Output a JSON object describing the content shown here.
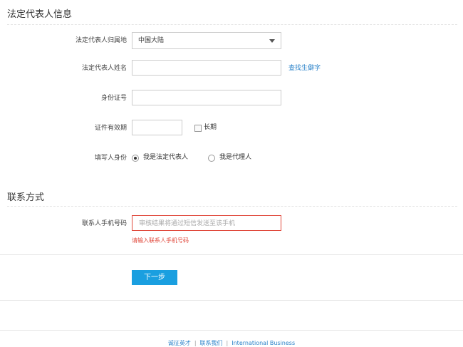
{
  "legal_section": {
    "title": "法定代表人信息",
    "region_label": "法定代表人归属地",
    "region_value": "中国大陆",
    "name_label": "法定代表人姓名",
    "name_value": "",
    "find_char_link": "查找生僻字",
    "id_label": "身份证号",
    "id_value": "",
    "validity_label": "证件有效期",
    "validity_value": "",
    "longterm_label": "长期",
    "filler_label": "填写人身份",
    "filler_option_self": "我是法定代表人",
    "filler_option_agent": "我是代理人",
    "filler_selected": "我是法定代表人"
  },
  "contact_section": {
    "title": "联系方式",
    "phone_label": "联系人手机号码",
    "phone_placeholder": "审核结果将通过短信发送至该手机",
    "phone_error": "请输入联系人手机号码"
  },
  "actions": {
    "next_label": "下一步"
  },
  "footer": {
    "links": [
      "诚征英才",
      "联系我们",
      "International Business"
    ],
    "separator": "|"
  },
  "colors": {
    "accent": "#1a9fe0",
    "link": "#2a82c9",
    "error": "#e0493c"
  }
}
